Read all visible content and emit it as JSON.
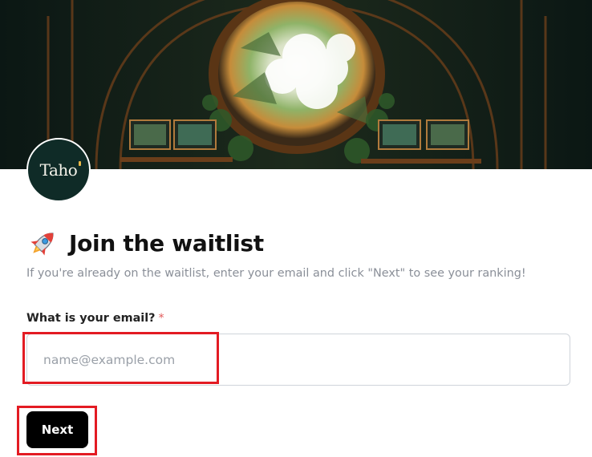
{
  "banner": {
    "image": "fantasy-portal-artwork"
  },
  "logo": {
    "text": "Taho"
  },
  "heading": {
    "icon": "rocket-icon",
    "title": "Join the waitlist"
  },
  "subtitle": "If you're already on the waitlist, enter your email and click \"Next\" to see your ranking!",
  "form": {
    "email_label": "What is your email?",
    "required_marker": "*",
    "email_placeholder": "name@example.com",
    "email_value": "",
    "next_label": "Next"
  },
  "colors": {
    "accent": "#000000",
    "highlight": "#e31b23",
    "required": "#e25c5c",
    "logo_bg": "#0f2b27"
  }
}
